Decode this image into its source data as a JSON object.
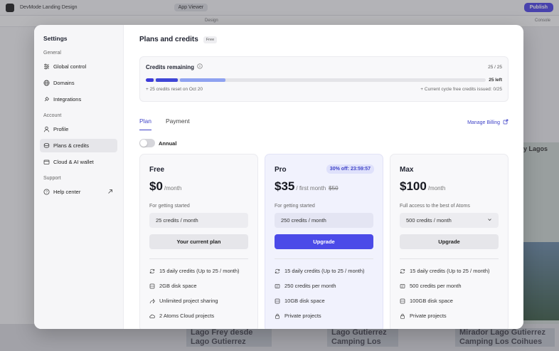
{
  "background": {
    "project_title": "DevMode Landing Design",
    "app_viewer_label": "App Viewer",
    "publish_label": "Publish",
    "design_label": "Design",
    "console_label": "Console",
    "cards": [
      "Lago Frey desde\nLago Gutierrez",
      "Lago Gutierrez\nCamping Los Coihues (direct",
      "Mirador Lago Gutierrez\nCamping Los Coihues (direct"
    ],
    "right_label": "y Lagos"
  },
  "sidebar": {
    "title": "Settings",
    "groups": [
      {
        "label": "General",
        "items": [
          {
            "label": "Global control",
            "icon": "sliders-icon"
          },
          {
            "label": "Domains",
            "icon": "globe-icon"
          },
          {
            "label": "Integrations",
            "icon": "plug-icon"
          }
        ]
      },
      {
        "label": "Account",
        "items": [
          {
            "label": "Profile",
            "icon": "user-icon"
          },
          {
            "label": "Plans & credits",
            "icon": "coins-icon",
            "active": true
          },
          {
            "label": "Cloud & AI wallet",
            "icon": "wallet-icon"
          }
        ]
      },
      {
        "label": "Support",
        "items": [
          {
            "label": "Help center",
            "icon": "help-icon",
            "external": true
          }
        ]
      }
    ]
  },
  "header": {
    "title": "Plans and credits",
    "badge": "Free"
  },
  "credits": {
    "label": "Credits remaining",
    "count": "25 / 25",
    "left": "25 left",
    "reset_note": "+ 25 credits reset on Oct 20",
    "cycle_note": "+ Current cycle free credits issued: 0/25",
    "bar": {
      "segments": [
        {
          "color": "#3d3ad9",
          "fraction": 0.03
        },
        {
          "color": "#3f46d6",
          "fraction": 0.07
        },
        {
          "color": "#8fa2f0",
          "fraction": 0.14
        }
      ]
    }
  },
  "tabs": [
    {
      "label": "Plan",
      "active": true
    },
    {
      "label": "Payment"
    }
  ],
  "manage_billing": "Manage Billing",
  "annual_label": "Annual",
  "plans": [
    {
      "name": "Free",
      "price": "$0",
      "period": "/month",
      "desc": "For getting started",
      "credits": "25 credits / month",
      "cta": "Your current plan",
      "features": [
        {
          "icon": "refresh-icon",
          "text": "15 daily credits (Up to 25 / month)"
        },
        {
          "icon": "disk-icon",
          "text": "2GB disk space"
        },
        {
          "icon": "share-icon",
          "text": "Unlimited project sharing"
        },
        {
          "icon": "cloud-icon",
          "text": "2 Atoms Cloud projects"
        }
      ]
    },
    {
      "name": "Pro",
      "discount": "30% off: 23:59:57",
      "price": "$35",
      "period": "/ first month",
      "old_price": "$50",
      "desc": "For getting started",
      "credits": "250 credits / month",
      "cta": "Upgrade",
      "features": [
        {
          "icon": "refresh-icon",
          "text": "15 daily credits (Up to 25 / month)"
        },
        {
          "icon": "credits-icon",
          "text": "250 credits per month"
        },
        {
          "icon": "disk-icon",
          "text": "10GB disk space"
        },
        {
          "icon": "lock-icon",
          "text": "Private projects"
        }
      ]
    },
    {
      "name": "Max",
      "price": "$100",
      "period": "/month",
      "desc": "Full access to the best of Atoms",
      "credits": "500 credits / month",
      "cta": "Upgrade",
      "features": [
        {
          "icon": "refresh-icon",
          "text": "15 daily credits (Up to 25 / month)"
        },
        {
          "icon": "credits-icon",
          "text": "500 credits per month"
        },
        {
          "icon": "disk-icon",
          "text": "100GB disk space"
        },
        {
          "icon": "lock-icon",
          "text": "Private projects"
        }
      ]
    }
  ]
}
